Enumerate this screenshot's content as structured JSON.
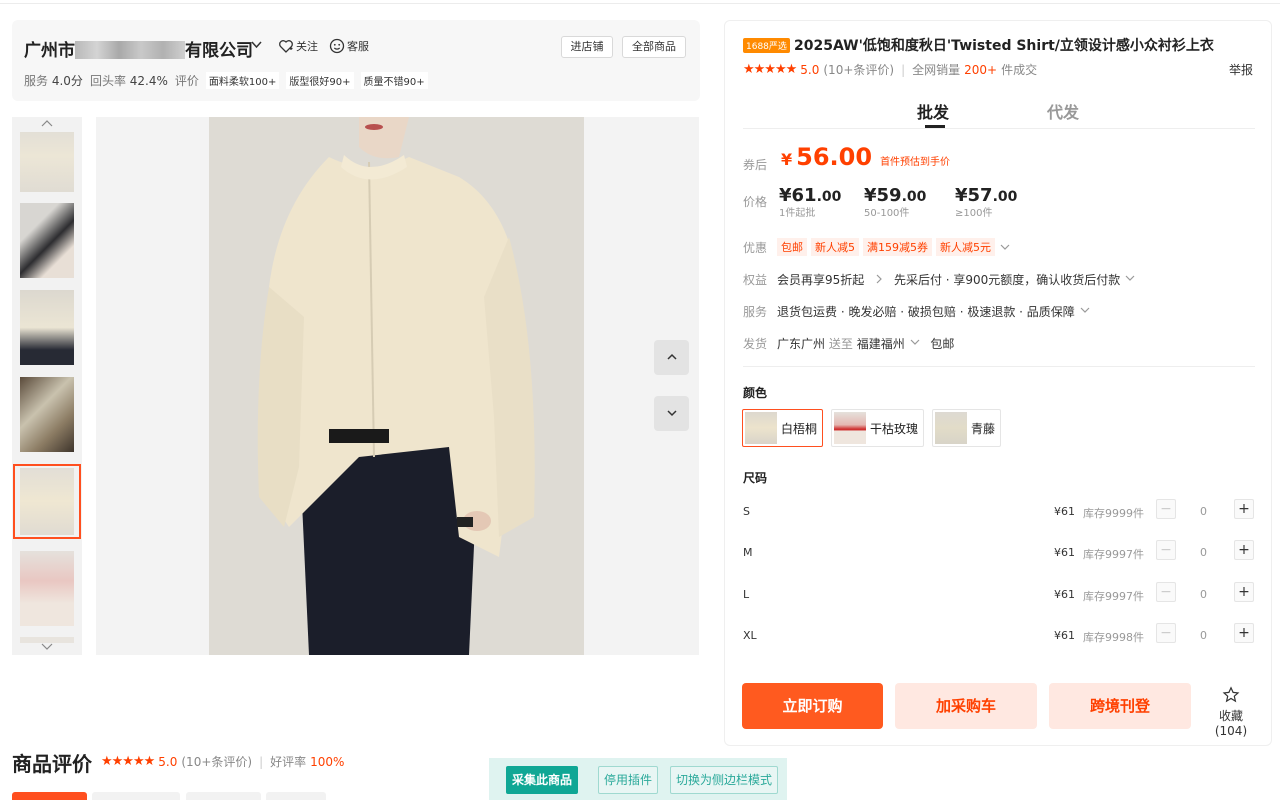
{
  "shop": {
    "name_prefix": "广州市",
    "name_suffix": "有限公司",
    "follow_label": "关注",
    "service_label": "客服",
    "enter_store_label": "进店铺",
    "all_products_label": "全部商品",
    "stats": {
      "service_label": "服务",
      "service_value": "4.0分",
      "repurchase_label": "回头率",
      "repurchase_value": "42.4%",
      "review_label": "评价",
      "tags": [
        "面料柔软100+",
        "版型很好90+",
        "质量不错90+"
      ]
    }
  },
  "gallery": {
    "thumb_up_icon": "chevron-up-icon",
    "thumb_down_icon": "chevron-down-icon",
    "selected_index": 4,
    "thumbnail_count": 6,
    "nav_up_icon": "chevron-up-icon",
    "nav_down_icon": "chevron-down-icon"
  },
  "product": {
    "badge": "1688严选",
    "title": "2025AW'低饱和度秋日'Twisted Shirt/立领设计感小众衬衫上衣",
    "rating_stars": "★★★★★",
    "rating_score": "5.0",
    "rating_count": "(10+条评价)",
    "sales_prefix": "全网销量",
    "sales_value": "200+",
    "sales_suffix": "件成交",
    "report_label": "举报"
  },
  "tabs": {
    "wholesale": "批发",
    "dropship": "代发"
  },
  "pricing": {
    "coupon_label": "券后",
    "currency": "¥",
    "coupon_price": "56.00",
    "coupon_note": "首件预估到手价",
    "price_label": "价格",
    "tiers": [
      {
        "int": "61",
        "dec": ".00",
        "range": "1件起批"
      },
      {
        "int": "59",
        "dec": ".00",
        "range": "50-100件"
      },
      {
        "int": "57",
        "dec": ".00",
        "range": "≥100件"
      }
    ]
  },
  "offers": {
    "label": "优惠",
    "tags": [
      "包邮",
      "新人减5",
      "满159减5券",
      "新人减5元"
    ]
  },
  "rights": {
    "label": "权益",
    "member": "会员再享95折起",
    "text": "先采后付 · 享900元额度，确认收货后付款"
  },
  "services": {
    "label": "服务",
    "text": "退货包运费 · 晚发必赔 · 破损包赔 · 极速退款 · 品质保障"
  },
  "shipping": {
    "label": "发货",
    "from": "广东广州",
    "to_word": "送至",
    "to": "福建福州",
    "free": "包邮"
  },
  "colors": {
    "title": "颜色",
    "options": [
      "白梧桐",
      "干枯玫瑰",
      "青藤"
    ],
    "selected": "白梧桐"
  },
  "sizes": {
    "title": "尺码",
    "rows": [
      {
        "name": "S",
        "price": "¥61",
        "stock": "库存9999件",
        "qty": "0"
      },
      {
        "name": "M",
        "price": "¥61",
        "stock": "库存9997件",
        "qty": "0"
      },
      {
        "name": "L",
        "price": "¥61",
        "stock": "库存9997件",
        "qty": "0"
      },
      {
        "name": "XL",
        "price": "¥61",
        "stock": "库存9998件",
        "qty": "0"
      }
    ]
  },
  "actions": {
    "buy_now": "立即订购",
    "add_cart": "加采购车",
    "cross_border": "跨境刊登",
    "favorite": "收藏(104)"
  },
  "reviews": {
    "title": "商品评价",
    "stars": "★★★★★",
    "score": "5.0",
    "count": "(10+条评价)",
    "good_rate_label": "好评率",
    "good_rate": "100%"
  },
  "plugin": {
    "collect": "采集此商品",
    "disable": "停用插件",
    "switch": "切换为侧边栏模式"
  },
  "colors_theme": {
    "accent": "#ff4000",
    "primary_button": "#ff5a1f",
    "plugin_green": "#10a795"
  }
}
